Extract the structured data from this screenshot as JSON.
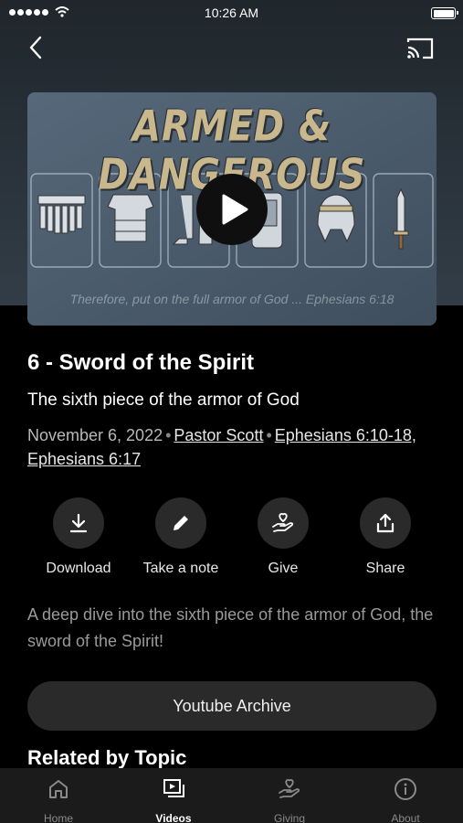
{
  "status_bar": {
    "time": "10:26 AM"
  },
  "thumbnail": {
    "heading": "ARMED & DANGEROUS",
    "quote": "Therefore, put on the full armor of God ... Ephesians 6:18"
  },
  "sermon": {
    "title": "6 - Sword of the Spirit",
    "subtitle": "The sixth piece of the armor of God",
    "date": "November 6, 2022",
    "separator": "•",
    "speaker": "Pastor Scott",
    "scripture": "Ephesians 6:10-18, Ephesians 6:17",
    "description": "A deep dive into the sixth piece of the armor of God, the sword of the Spirit!"
  },
  "actions": [
    {
      "label": "Download",
      "icon": "download-icon"
    },
    {
      "label": "Take a note",
      "icon": "pencil-icon"
    },
    {
      "label": "Give",
      "icon": "give-icon"
    },
    {
      "label": "Share",
      "icon": "share-icon"
    }
  ],
  "archive_button": {
    "label": "Youtube Archive"
  },
  "related": {
    "heading": "Related by Topic"
  },
  "tabs": [
    {
      "label": "Home",
      "icon": "home-icon",
      "active": false
    },
    {
      "label": "Videos",
      "icon": "videos-icon",
      "active": true
    },
    {
      "label": "Giving",
      "icon": "giving-icon",
      "active": false
    },
    {
      "label": "About",
      "icon": "info-icon",
      "active": false
    }
  ],
  "colors": {
    "background": "#000000",
    "hero_top": "#1f262c",
    "button_bg": "#2a2a2a",
    "tab_bar": "#1b1b1b",
    "heading_gold": "#c9b78d"
  }
}
